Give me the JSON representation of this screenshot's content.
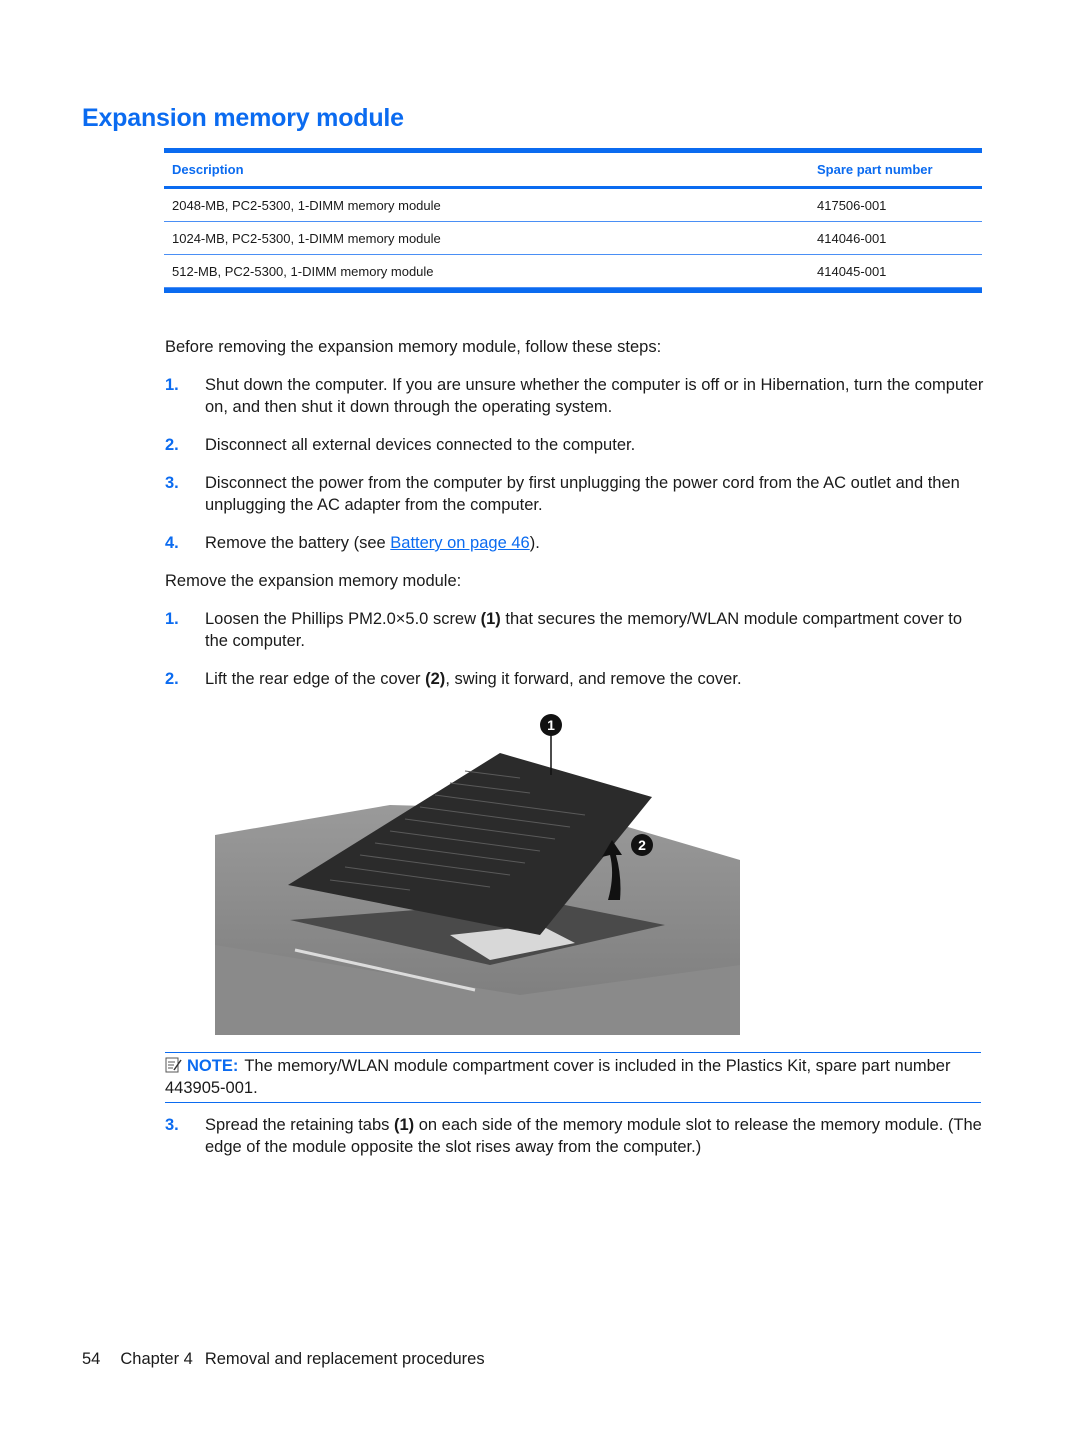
{
  "page": {
    "title": "Expansion memory module",
    "table": {
      "headers": [
        "Description",
        "Spare part number"
      ],
      "rows": [
        {
          "description": "2048-MB, PC2-5300, 1-DIMM memory module",
          "part": "417506-001"
        },
        {
          "description": "1024-MB, PC2-5300, 1-DIMM memory module",
          "part": "414046-001"
        },
        {
          "description": "512-MB, PC2-5300, 1-DIMM memory module",
          "part": "414045-001"
        }
      ]
    },
    "intro": "Before removing the expansion memory module, follow these steps:",
    "prep_steps": [
      {
        "num": "1.",
        "text": "Shut down the computer. If you are unsure whether the computer is off or in Hibernation, turn the computer on, and then shut it down through the operating system."
      },
      {
        "num": "2.",
        "text": "Disconnect all external devices connected to the computer."
      },
      {
        "num": "3.",
        "text": "Disconnect the power from the computer by first unplugging the power cord from the AC outlet and then unplugging the AC adapter from the computer."
      },
      {
        "num": "4.",
        "text_before": "Remove the battery (see ",
        "link": "Battery on page 46",
        "text_after": ")."
      }
    ],
    "remove_intro": "Remove the expansion memory module:",
    "remove_steps": [
      {
        "num": "1.",
        "text_before": "Loosen the Phillips PM2.0×5.0 screw ",
        "bold": "(1)",
        "text_after": " that secures the memory/WLAN module compartment cover to the computer."
      },
      {
        "num": "2.",
        "text_before": "Lift the rear edge of the cover ",
        "bold": "(2)",
        "text_after": ", swing it forward, and remove the cover."
      },
      {
        "num": "3.",
        "text_before": "Spread the retaining tabs ",
        "bold": "(1)",
        "text_after": " on each side of the memory module slot to release the memory module. (The edge of the module opposite the slot rises away from the computer.)"
      }
    ],
    "figure": {
      "callouts": [
        "1",
        "2"
      ]
    },
    "note": {
      "icon": "note-pencil-icon",
      "label": "NOTE:",
      "text": "The memory/WLAN module compartment cover is included in the Plastics Kit, spare part number 443905-001."
    },
    "footer": {
      "page_number": "54",
      "chapter": "Chapter 4",
      "chapter_title": "Removal and replacement procedures"
    }
  }
}
